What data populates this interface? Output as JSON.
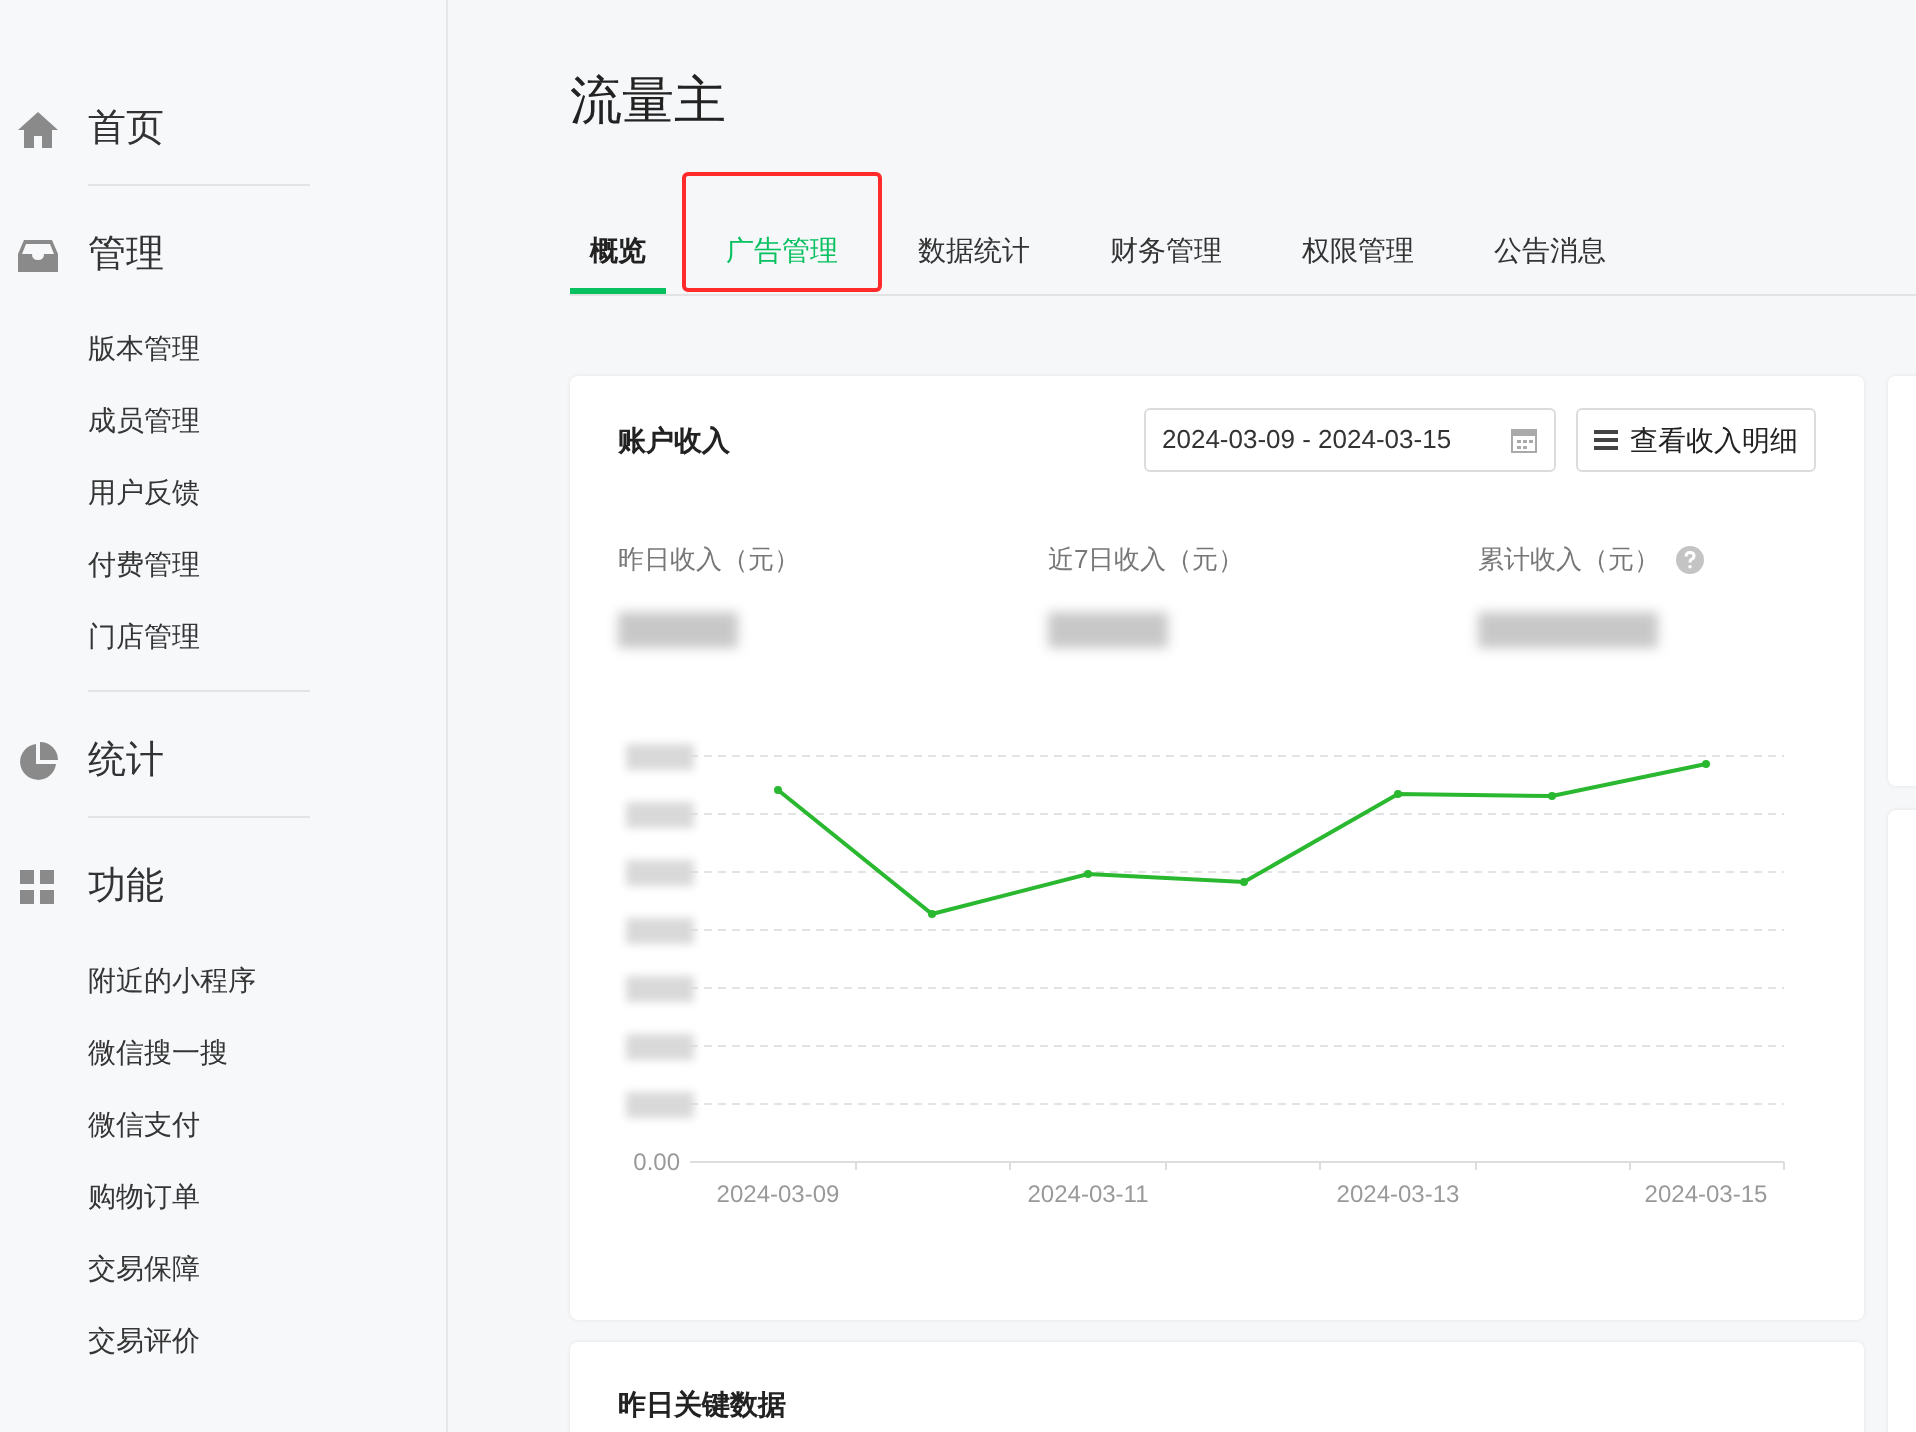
{
  "sidebar": {
    "sections": [
      {
        "kind": "home",
        "label": "首页"
      },
      {
        "kind": "inbox",
        "label": "管理",
        "items": [
          "版本管理",
          "成员管理",
          "用户反馈",
          "付费管理",
          "门店管理"
        ]
      },
      {
        "kind": "pie",
        "label": "统计"
      },
      {
        "kind": "grid",
        "label": "功能",
        "items": [
          "附近的小程序",
          "微信搜一搜",
          "微信支付",
          "购物订单",
          "交易保障",
          "交易评价"
        ]
      }
    ]
  },
  "page": {
    "title": "流量主"
  },
  "tabs": [
    {
      "label": "概览",
      "selected": true,
      "highlighted": false
    },
    {
      "label": "广告管理",
      "selected": false,
      "highlighted": true
    },
    {
      "label": "数据统计",
      "selected": false,
      "highlighted": false
    },
    {
      "label": "财务管理",
      "selected": false,
      "highlighted": false
    },
    {
      "label": "权限管理",
      "selected": false,
      "highlighted": false
    },
    {
      "label": "公告消息",
      "selected": false,
      "highlighted": false
    }
  ],
  "income_card": {
    "title": "账户收入",
    "date_range": "2024-03-09 - 2024-03-15",
    "detail_button": "查看收入明细",
    "stats": [
      {
        "label": "昨日收入（元）",
        "help": false
      },
      {
        "label": "近7日收入（元）",
        "help": false
      },
      {
        "label": "累计收入（元）",
        "help": true
      }
    ],
    "chart": {
      "y_axis_zero": "0.00",
      "x_labels": [
        "2024-03-09",
        "2024-03-11",
        "2024-03-13",
        "2024-03-15"
      ]
    }
  },
  "key_data_card": {
    "title": "昨日关键数据"
  }
}
